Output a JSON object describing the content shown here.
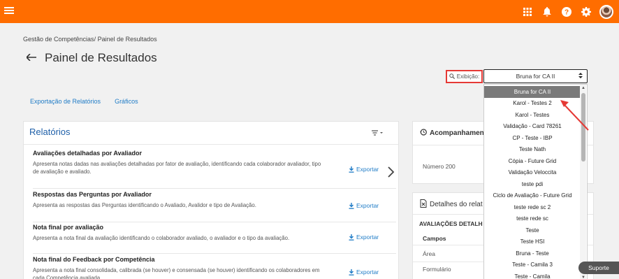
{
  "topbar": {
    "menu_icon": "menu-icon",
    "icons": [
      "apps-grid-icon",
      "bell-icon",
      "help-icon",
      "gear-icon",
      "avatar"
    ],
    "color": "#ff6d00"
  },
  "breadcrumb": {
    "parent": "Gestão de Competências",
    "separator": "/",
    "current": "Painel de Resultados"
  },
  "page": {
    "title": "Painel de Resultados"
  },
  "exibicao": {
    "label": "Exibição:",
    "selected": "Bruna for CA II",
    "options": [
      "Bruna for CA II",
      "Karol - Testes 2",
      "Karol - Testes",
      "Validação - Card 78261",
      "CP - Teste - IBP",
      "Teste Nath",
      "Cópia - Future Grid",
      "Validação Veloccita",
      "teste pdi",
      "Ciclo de Avaliação - Future Grid",
      "teste rede sc 2",
      "teste rede sc",
      "Teste",
      "Teste HSI",
      "Bruna - Teste",
      "Teste - Camila 3",
      "Teste - Camila"
    ]
  },
  "tabs": [
    "Exportação de Relatórios",
    "Gráficos"
  ],
  "relatorios": {
    "title": "Relatórios",
    "items": [
      {
        "title": "Avaliações detalhadas por Avaliador",
        "desc": "Apresenta notas dadas nas avaliações detalhadas por fator de avaliação, identificando cada colaborador avaliador, tipo de avaliação e avaliado.",
        "action": "Exportar"
      },
      {
        "title": "Respostas das Perguntas por Avaliador",
        "desc": "Apresenta as respostas das Perguntas identificando o Avaliado, Avalidor e tipo de Avaliação.",
        "action": "Exportar"
      },
      {
        "title": "Nota final por avaliação",
        "desc": "Apresenta a nota final da avaliação identificando o colaborador avaliado, o avaliador e o tipo da avaliação.",
        "action": "Exportar"
      },
      {
        "title": "Nota final do Feedback por Competência",
        "desc": "Apresenta a nota final consolidada, calibrada (se houver) e consensada (se houver) identificando os colaboradores em cada Competência avaliada.",
        "action": "Exportar"
      }
    ]
  },
  "acompanhamento": {
    "title": "Acompanhamen",
    "row_label": "Número 200"
  },
  "detalhes": {
    "title": "Detalhes do relat",
    "section": "AVALIAÇÕES DETALH",
    "column": "Campos",
    "rows": [
      "Área",
      "Formulário"
    ]
  },
  "suporte": {
    "label": "Suporte"
  }
}
